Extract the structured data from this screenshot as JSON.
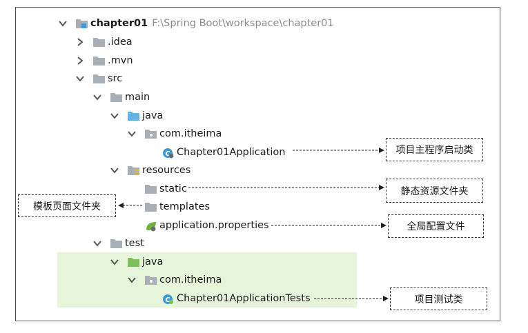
{
  "tree": {
    "root": {
      "label": "chapter01",
      "path": "F:\\Spring Boot\\workspace\\chapter01"
    },
    "idea": "idea",
    "mvn": "mvn",
    "src": "src",
    "main": "main",
    "main_java": "java",
    "main_package": "com.itheima",
    "app_class": "Chapter01Application",
    "resources": "resources",
    "static": "static",
    "templates": "templates",
    "properties": "application.properties",
    "test": "test",
    "test_java": "java",
    "test_package": "com.itheima",
    "test_class": "Chapter01ApplicationTests"
  },
  "annotations": {
    "main_class": "项目主程序启动类",
    "static": "静态资源文件夹",
    "templates": "模板页面文件夹",
    "properties": "全局配置文件",
    "tests": "项目测试类"
  },
  "colors": {
    "folder_gray": "#a9afb7",
    "folder_blue": "#62b2e6",
    "folder_green": "#7dbf5a",
    "test_highlight": "#e6f5d9",
    "class_badge": "#3d9bd6"
  }
}
